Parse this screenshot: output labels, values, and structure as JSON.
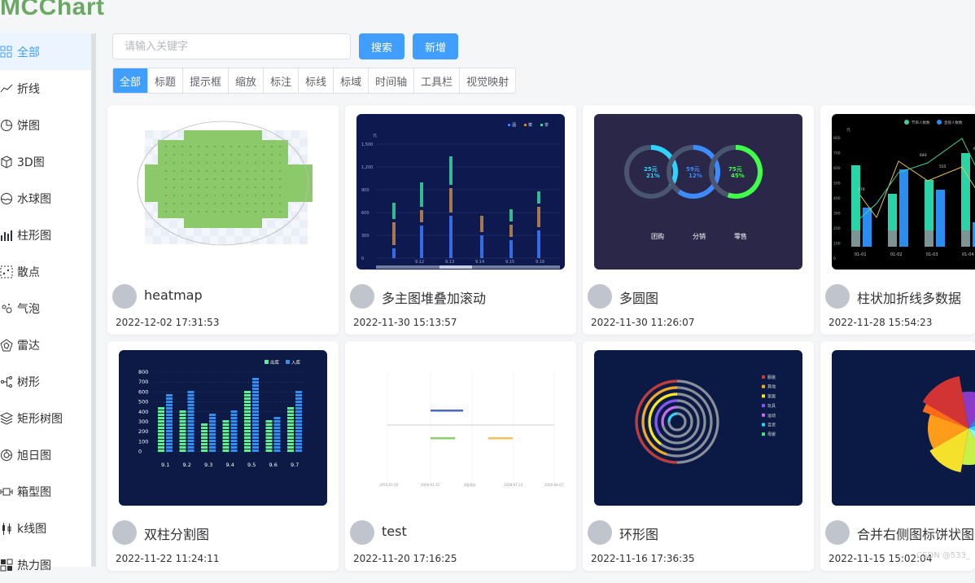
{
  "app": {
    "logo": "MCChart"
  },
  "sidebar": {
    "items": [
      {
        "label": "全部",
        "icon": "grid-icon",
        "active": true
      },
      {
        "label": "折线",
        "icon": "line-chart-icon"
      },
      {
        "label": "饼图",
        "icon": "pie-chart-icon"
      },
      {
        "label": "3D图",
        "icon": "cube-icon"
      },
      {
        "label": "水球图",
        "icon": "liquid-ball-icon"
      },
      {
        "label": "柱形图",
        "icon": "bar-chart-icon"
      },
      {
        "label": "散点",
        "icon": "scatter-icon"
      },
      {
        "label": "气泡",
        "icon": "bubble-icon"
      },
      {
        "label": "雷达",
        "icon": "radar-icon"
      },
      {
        "label": "树形",
        "icon": "tree-icon"
      },
      {
        "label": "矩形树图",
        "icon": "treemap-icon"
      },
      {
        "label": "旭日图",
        "icon": "sunburst-icon"
      },
      {
        "label": "箱型图",
        "icon": "boxplot-icon"
      },
      {
        "label": "k线图",
        "icon": "candlestick-icon"
      },
      {
        "label": "热力图",
        "icon": "heatmap-icon"
      }
    ]
  },
  "toolbar": {
    "search_placeholder": "请输入关键字",
    "search_label": "搜索",
    "add_label": "新增"
  },
  "tabs": [
    "全部",
    "标题",
    "提示框",
    "缩放",
    "标注",
    "标线",
    "标域",
    "时间轴",
    "工具栏",
    "视觉映射"
  ],
  "cards": [
    {
      "title": "heatmap",
      "date": "2022-12-02 17:31:53"
    },
    {
      "title": "多主图堆叠加滚动",
      "date": "2022-11-30 15:13:57"
    },
    {
      "title": "多圆图",
      "date": "2022-11-30 11:26:07"
    },
    {
      "title": "柱状加折线多数据",
      "date": "2022-11-28 15:54:23"
    },
    {
      "title": "双柱分割图",
      "date": "2022-11-22 11:24:11"
    },
    {
      "title": "test",
      "date": "2022-11-20 17:16:25"
    },
    {
      "title": "环形图",
      "date": "2022-11-16 17:36:35"
    },
    {
      "title": "合并右侧图标饼状图",
      "date": "2022-11-15 15:02:04"
    }
  ],
  "thumbs": {
    "stack": {
      "ylabel": "元",
      "yticks": [
        "1,500",
        "1,200",
        "900",
        "600",
        "300",
        "0"
      ],
      "xticks": [
        "9.12",
        "9.13",
        "9.14",
        "9.15",
        "9.16"
      ],
      "legend": [
        "酒",
        "菜",
        "茶"
      ]
    },
    "circles": {
      "rings": [
        {
          "l1": "25元",
          "l2": "21%"
        },
        {
          "l1": "59元",
          "l2": "12%"
        },
        {
          "l1": "75元",
          "l2": "45%"
        }
      ],
      "labels": [
        "团购",
        "分销",
        "零售"
      ]
    },
    "barline": {
      "ylabel": "元",
      "yticks": [
        "800",
        "700",
        "600",
        "500",
        "400",
        "300",
        "200",
        "100",
        "0"
      ],
      "xticks": [
        "01-01",
        "01-02",
        "01-03",
        "01-04",
        "01-05"
      ],
      "legend": [
        "节目人数数",
        "直接人数数"
      ],
      "points": [
        "370",
        "640",
        "555",
        "600"
      ]
    },
    "dbar": {
      "legend": [
        "出库",
        "入库"
      ],
      "yticks": [
        "800",
        "700",
        "600",
        "500",
        "400",
        "300",
        "200",
        "100",
        "0"
      ],
      "xticks": [
        "9.1",
        "9.2",
        "9.3",
        "9.4",
        "9.5",
        "9.6",
        "9.7"
      ]
    },
    "test": {
      "xticks": [
        "1955-01-05",
        "2009-01-15",
        "4组测试",
        "2008-07-23",
        "2000-04-07"
      ]
    },
    "ring": {
      "legend": [
        "服装",
        "其他",
        "家居",
        "玩具",
        "运动",
        "百货",
        "母婴"
      ]
    }
  },
  "watermark": "CSDN @533_",
  "colors": {
    "accent": "#409eff",
    "dark_navy": "#0d1b4a",
    "heat_green": "#8cc96a"
  }
}
